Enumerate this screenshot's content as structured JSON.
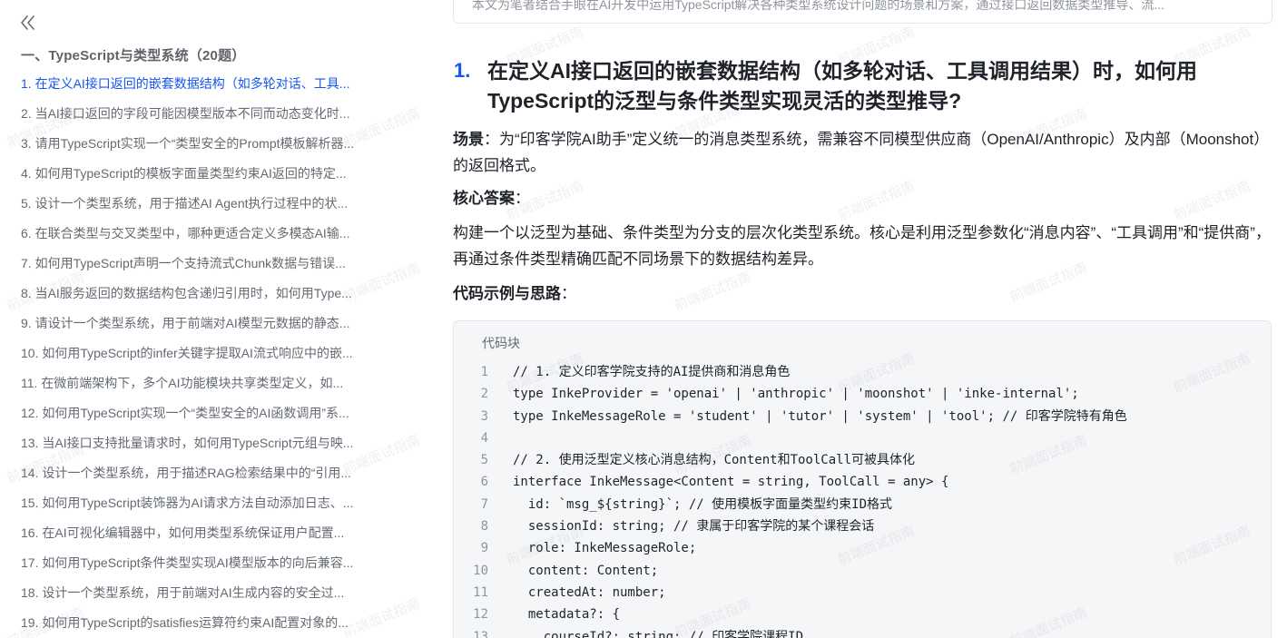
{
  "sidebar": {
    "collapse_icon": "double-chevron-left-icon",
    "section_title": "一、TypeScript与类型系统（20题）",
    "items": [
      "1. 在定义AI接口返回的嵌套数据结构（如多轮对话、工具...",
      "2. 当AI接口返回的字段可能因模型版本不同而动态变化时...",
      "3. 请用TypeScript实现一个“类型安全的Prompt模板解析器...",
      "4. 如何用TypeScript的模板字面量类型约束AI返回的特定...",
      "5. 设计一个类型系统，用于描述AI Agent执行过程中的状...",
      "6. 在联合类型与交叉类型中，哪种更适合定义多模态AI输...",
      "7. 如何用TypeScript声明一个支持流式Chunk数据与错误...",
      "8. 当AI服务返回的数据结构包含递归引用时，如何用Type...",
      "9. 请设计一个类型系统，用于前端对AI模型元数据的静态...",
      "10. 如何用TypeScript的infer关键字提取AI流式响应中的嵌...",
      "11. 在微前端架构下，多个AI功能模块共享类型定义，如...",
      "12. 如何用TypeScript实现一个“类型安全的AI函数调用”系...",
      "13. 当AI接口支持批量请求时，如何用TypeScript元组与映...",
      "14. 设计一个类型系统，用于描述RAG检索结果中的“引用...",
      "15. 如何用TypeScript装饰器为AI请求方法自动添加日志、...",
      "16. 在AI可视化编辑器中，如何用类型系统保证用户配置...",
      "17. 如何用TypeScript条件类型实现AI模型版本的向后兼容...",
      "18. 设计一个类型系统，用于前端对AI生成内容的安全过...",
      "19. 如何用TypeScript的satisfies运算符约束AI配置对象的..."
    ],
    "active_index": 0
  },
  "main": {
    "top_card_text": "本文为笔者结合手眼在AI开发中运用TypeScript解决各种类型系统设计问题的场景和方案，通过接口返回数据类型推导、流...",
    "question_number": "1.",
    "question_title": "在定义AI接口返回的嵌套数据结构（如多轮对话、工具调用结果）时，如何用TypeScript的泛型与条件类型实现灵活的类型推导?",
    "scene_label": "场景",
    "scene_text": "：为“印客学院AI助手”定义统一的消息类型系统，需兼容不同模型供应商（OpenAI/Anthropic）及内部（Moonshot）的返回格式。",
    "answer_label": "核心答案",
    "answer_colon": "：",
    "answer_text": "构建一个以泛型为基础、条件类型为分支的层次化类型系统。核心是利用泛型参数化“消息内容”、“工具调用”和“提供商”，再通过条件类型精确匹配不同场景下的数据结构差异。",
    "code_heading_label": "代码示例与思路",
    "code_heading_colon": "：",
    "code_block_label": "代码块",
    "code_lines": [
      "// 1. 定义印客学院支持的AI提供商和消息角色",
      "type InkeProvider = 'openai' | 'anthropic' | 'moonshot' | 'inke-internal';",
      "type InkeMessageRole = 'student' | 'tutor' | 'system' | 'tool'; // 印客学院特有角色",
      "",
      "// 2. 使用泛型定义核心消息结构，Content和ToolCall可被具体化",
      "interface InkeMessage<Content = string, ToolCall = any> {",
      "  id: `msg_${string}`; // 使用模板字面量类型约束ID格式",
      "  sessionId: string; // 隶属于印客学院的某个课程会话",
      "  role: InkeMessageRole;",
      "  content: Content;",
      "  createdAt: number;",
      "  metadata?: {",
      "    courseId?: string; // 印客学院课程ID"
    ]
  },
  "watermark_text": "前端面试指南"
}
